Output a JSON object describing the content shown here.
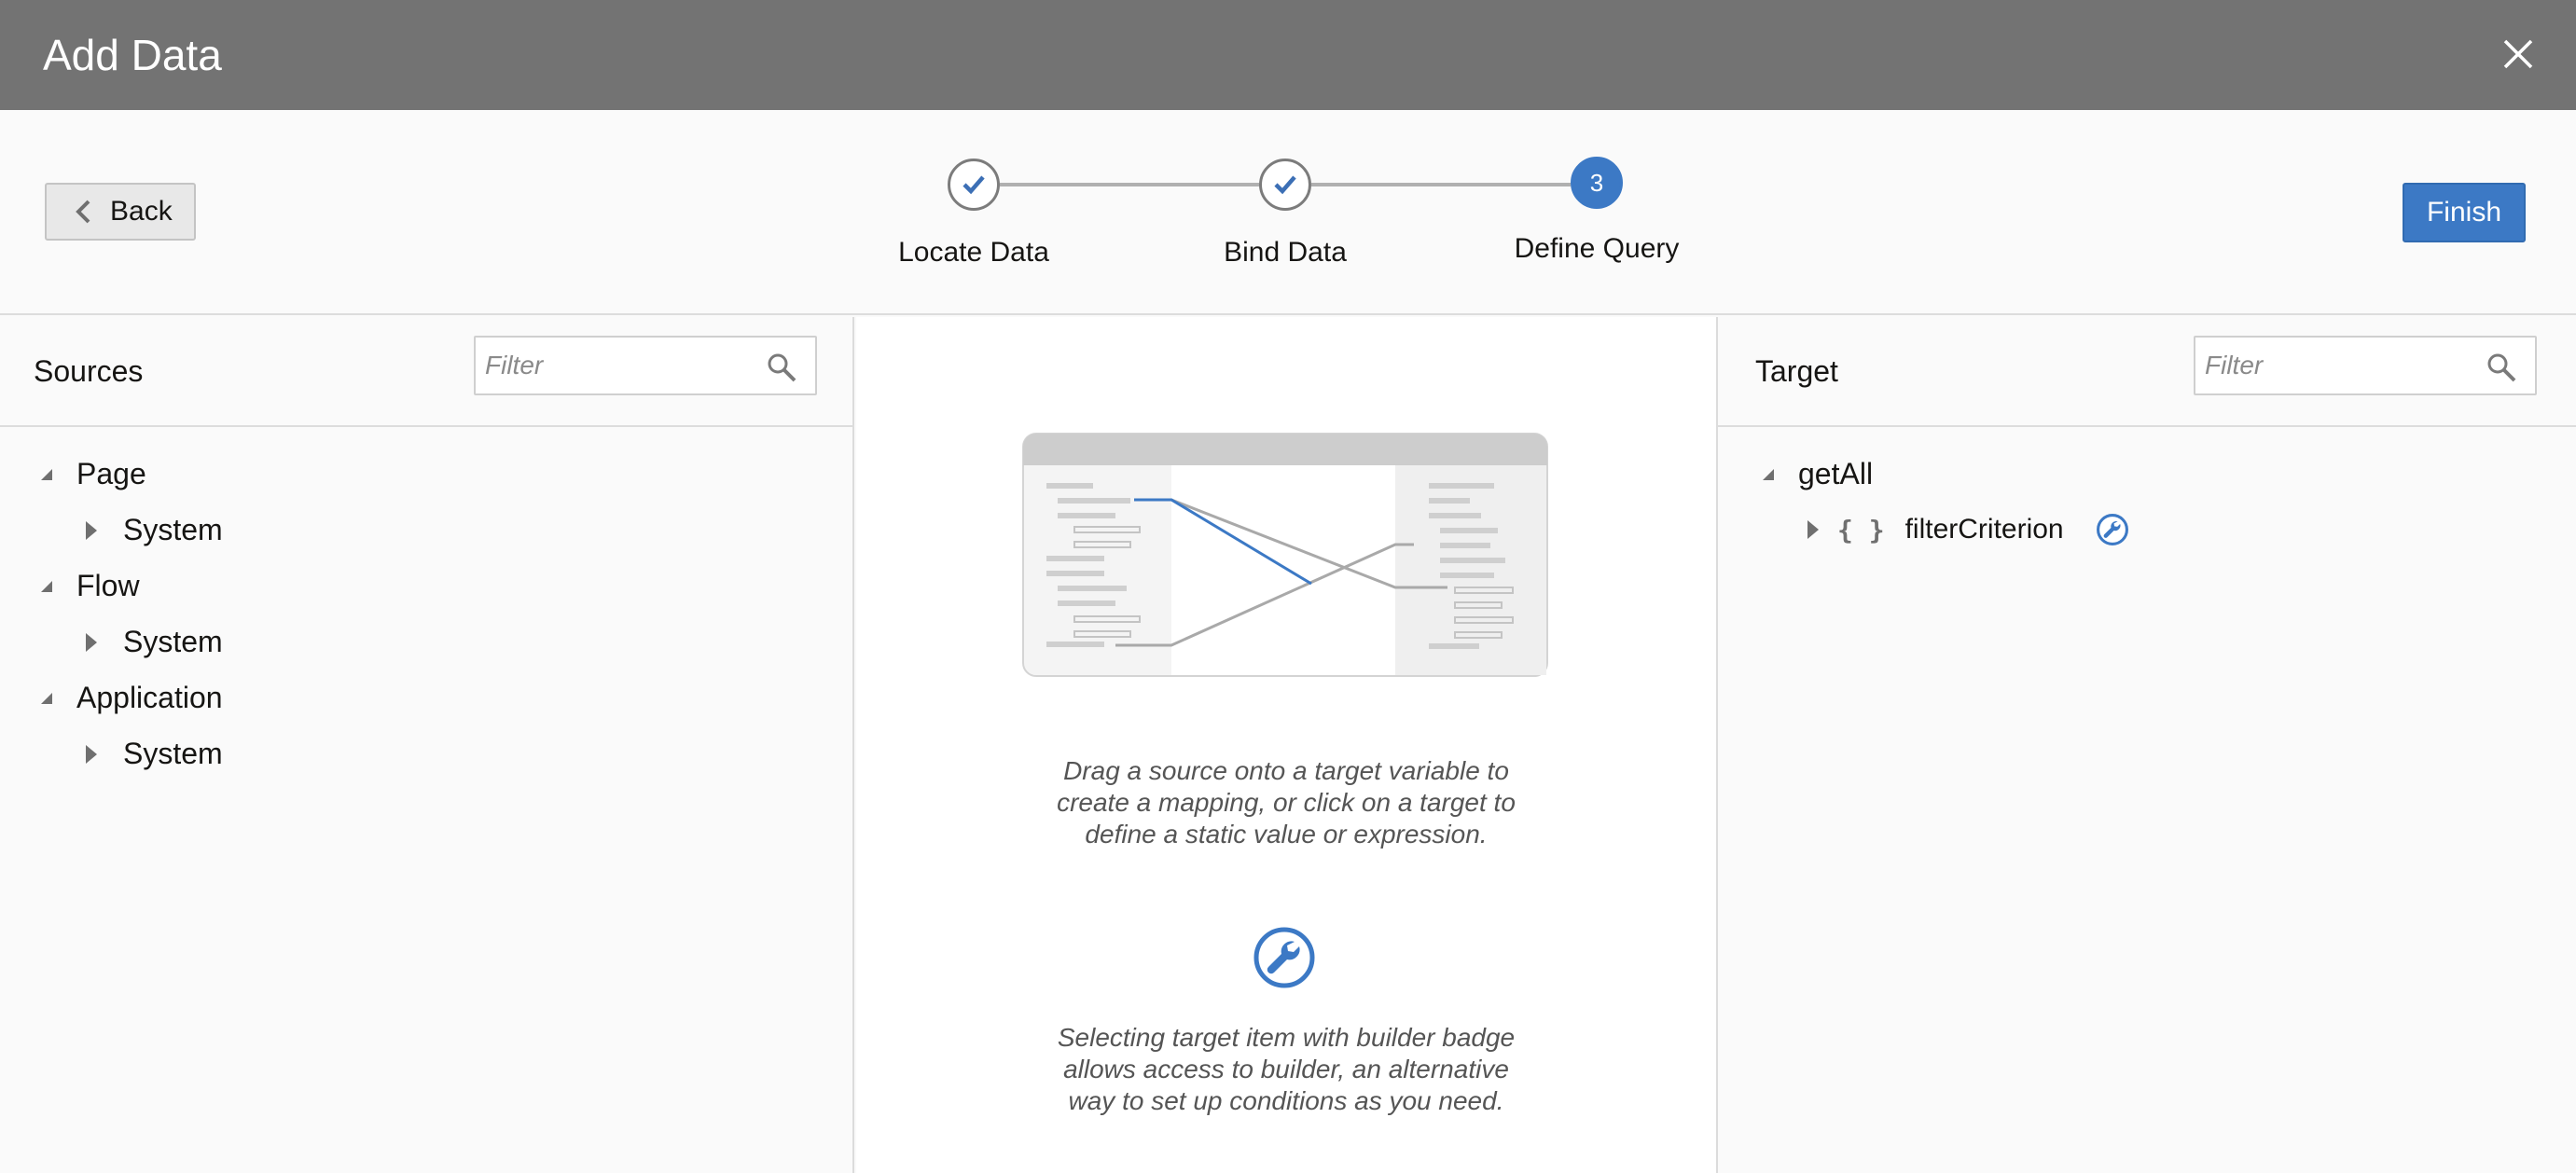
{
  "dialog": {
    "title": "Add Data"
  },
  "toolbar": {
    "back_label": "Back",
    "finish_label": "Finish"
  },
  "train": {
    "steps": [
      {
        "label": "Locate Data",
        "state": "complete"
      },
      {
        "label": "Bind Data",
        "state": "complete"
      },
      {
        "label": "Define Query",
        "state": "current",
        "number": "3"
      }
    ]
  },
  "sources": {
    "title": "Sources",
    "filter_placeholder": "Filter",
    "tree": [
      {
        "label": "Page",
        "expanded": true,
        "children": [
          {
            "label": "System"
          }
        ]
      },
      {
        "label": "Flow",
        "expanded": true,
        "children": [
          {
            "label": "System"
          }
        ]
      },
      {
        "label": "Application",
        "expanded": true,
        "children": [
          {
            "label": "System"
          }
        ]
      }
    ]
  },
  "center": {
    "hint_mapping": "Drag a source onto a target variable to create a mapping, or click on a target to define a static value or expression.",
    "hint_mapping_lines": [
      "Drag a source onto a target variable to",
      "create a mapping, or click on a target to",
      "define a static value or expression."
    ],
    "hint_builder_lines": [
      "Selecting target item with builder badge",
      "allows access to builder, an alternative",
      "way to set up conditions as you need."
    ]
  },
  "target": {
    "title": "Target",
    "filter_placeholder": "Filter",
    "tree": [
      {
        "label": "getAll",
        "expanded": true,
        "children": [
          {
            "label": "filterCriterion",
            "type_icon": "{ }",
            "badge": "builder-badge-icon"
          }
        ]
      }
    ]
  },
  "colors": {
    "header": "#737373",
    "accent": "#3c79c5",
    "check": "#3c6fb5"
  }
}
